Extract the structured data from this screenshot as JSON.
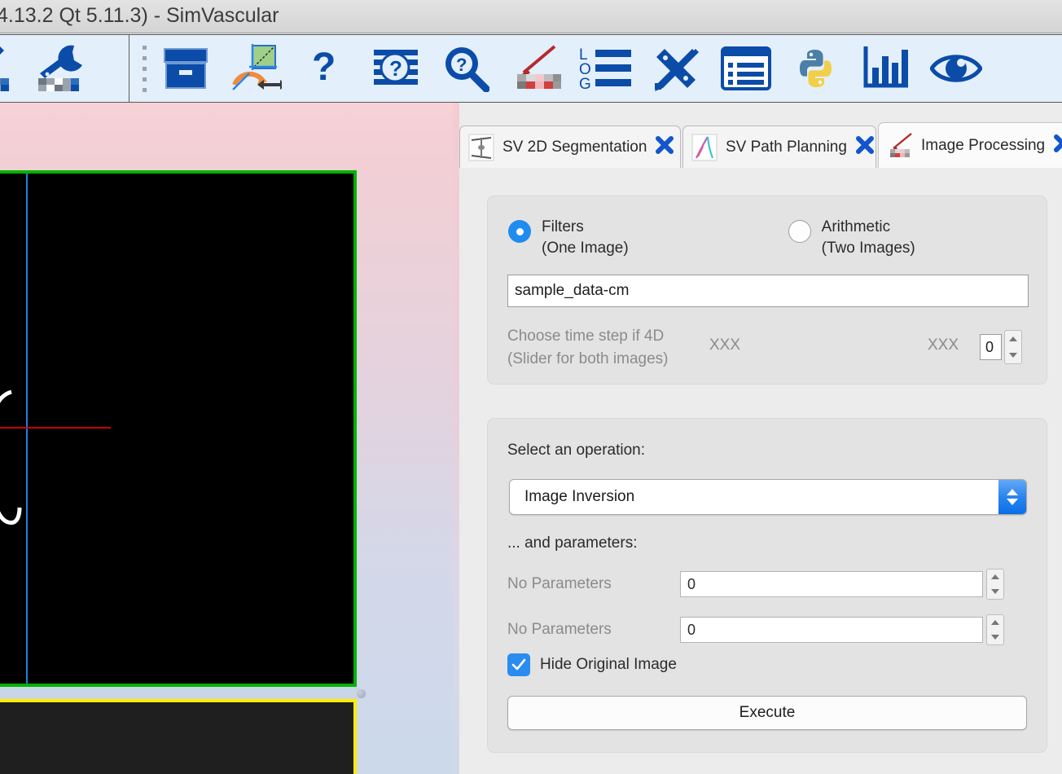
{
  "window": {
    "title": "4.13.2 Qt 5.11.3)  -  SimVascular"
  },
  "toolbar_left": {
    "buttons": [
      {
        "name": "pencil-data-icon",
        "tooltip": "Edit Data"
      },
      {
        "name": "wrench-data-icon",
        "tooltip": "Tools"
      }
    ]
  },
  "toolbar_main": {
    "buttons": [
      {
        "name": "box-icon",
        "tooltip": "Data Manager"
      },
      {
        "name": "measurement-axes-icon",
        "tooltip": "Measurement"
      },
      {
        "name": "question-mark-icon",
        "tooltip": "Help"
      },
      {
        "name": "context-help-icon",
        "tooltip": "Context Help"
      },
      {
        "name": "search-help-icon",
        "tooltip": "Search Help"
      },
      {
        "name": "red-pen-image-icon",
        "tooltip": "Annotation"
      },
      {
        "name": "log-list-icon",
        "tooltip": "Log"
      },
      {
        "name": "ruler-pencil-icon",
        "tooltip": "Measure Tools"
      },
      {
        "name": "properties-list-icon",
        "tooltip": "Properties"
      },
      {
        "name": "python-icon",
        "tooltip": "Python Console"
      },
      {
        "name": "bar-chart-icon",
        "tooltip": "Plots"
      },
      {
        "name": "eye-icon",
        "tooltip": "Visibility"
      }
    ]
  },
  "tabs": [
    {
      "label": "SV 2D Segmentation",
      "icon": "segmentation-icon",
      "active": false,
      "close": "✖"
    },
    {
      "label": "SV Path Planning",
      "icon": "path-planning-icon",
      "active": false,
      "close": "✖"
    },
    {
      "label": "Image Processing",
      "icon": "image-processing-icon",
      "active": true,
      "close": "✖"
    }
  ],
  "source_group": {
    "radios": [
      {
        "label_line1": "Filters",
        "label_line2": "(One Image)",
        "selected": true
      },
      {
        "label_line1": "Arithmetic",
        "label_line2": "(Two Images)",
        "selected": false
      }
    ],
    "image_name_value": "sample_data-cm",
    "image_name_placeholder": "",
    "hint_line1": "Choose time step if 4D",
    "hint_line2": "(Slider for both images)",
    "slider_min_label": "XXX",
    "slider_max_label": "XXX",
    "time_step_value": "0"
  },
  "operation_group": {
    "select_label": "Select an operation:",
    "selected_operation": "Image Inversion",
    "params_label": "... and parameters:",
    "parameters": [
      {
        "label": "No Parameters",
        "value": "0"
      },
      {
        "label": "No Parameters",
        "value": "0"
      }
    ],
    "hide_original_label": "Hide Original Image",
    "hide_original_checked": true,
    "execute_label": "Execute"
  },
  "colors": {
    "accent_blue": "#0a6ee8",
    "toolbar_bg": "#e3effb",
    "icon_blue": "#0b4ca8",
    "panel_bg": "#ececec",
    "group_bg": "#e3e3e3",
    "axial_border_green": "#00b200",
    "lower_border_yellow": "#ffec00",
    "crosshair_blue": "#1a7fe8",
    "crosshair_red": "#cc0000",
    "pink_top": "#f7d1d5",
    "gradient_bottom_blue": "#cbd9ea"
  }
}
